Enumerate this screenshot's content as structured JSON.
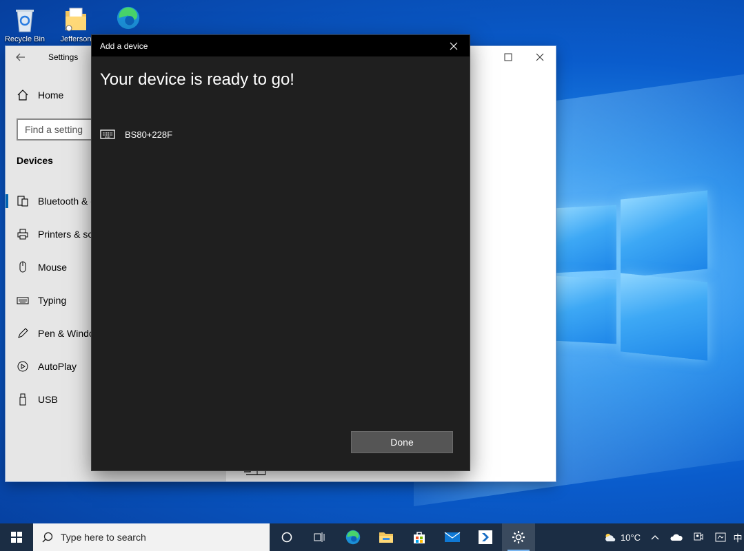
{
  "desktop": {
    "icons": [
      {
        "label": "Recycle Bin"
      },
      {
        "label": "Jefferson"
      },
      {
        "label": ""
      }
    ]
  },
  "settings": {
    "title": "Settings",
    "home_label": "Home",
    "search_placeholder": "Find a setting",
    "section_heading": "Devices",
    "nav_items": [
      {
        "label": "Bluetooth & other devices",
        "icon": "bluetooth-devices-icon"
      },
      {
        "label": "Printers & scanners",
        "icon": "printer-icon"
      },
      {
        "label": "Mouse",
        "icon": "mouse-icon"
      },
      {
        "label": "Typing",
        "icon": "keyboard-icon"
      },
      {
        "label": "Pen & Windows Ink",
        "icon": "pen-icon"
      },
      {
        "label": "AutoPlay",
        "icon": "autoplay-icon"
      },
      {
        "label": "USB",
        "icon": "usb-icon"
      }
    ]
  },
  "dialog": {
    "title": "Add a device",
    "heading": "Your device is ready to go!",
    "device_name": "BS80+228F",
    "done_label": "Done"
  },
  "taskbar": {
    "search_placeholder": "Type here to search",
    "temperature": "10°C"
  },
  "colors": {
    "accent": "#0063b1",
    "dialog_bg": "#1f1f1f",
    "taskbar_bg": "#1b2d44"
  }
}
